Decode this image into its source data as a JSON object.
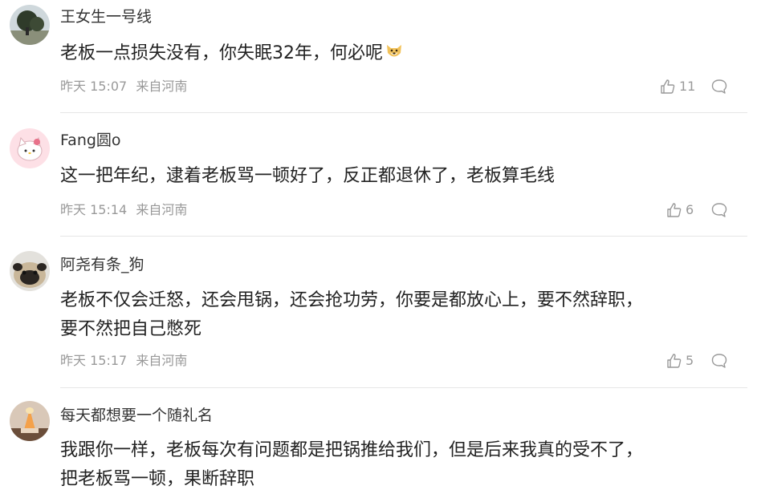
{
  "comments": [
    {
      "username": "王女生一号线",
      "content_lines": [
        "老板一点损失没有，你失眠32年，何必呢"
      ],
      "content_emoji": "dog-face-emoji",
      "date": "昨天",
      "time": "15:07",
      "location": "来自河南",
      "likes": "11",
      "avatar": "landscape-avatar"
    },
    {
      "username": "Fang圆o",
      "content_lines": [
        "这一把年纪，逮着老板骂一顿好了，反正都退休了，老板算毛线"
      ],
      "date": "昨天",
      "time": "15:14",
      "location": "来自河南",
      "likes": "6",
      "avatar": "hello-kitty-avatar"
    },
    {
      "username": "阿尧有条_狗",
      "content_lines": [
        "老板不仅会迁怒，还会甩锅，还会抢功劳，你要是都放心上，要不然辞职，",
        "要不然把自己憋死"
      ],
      "date": "昨天",
      "time": "15:17",
      "location": "来自河南",
      "likes": "5",
      "avatar": "pug-avatar"
    },
    {
      "username": "每天都想要一个随礼名",
      "content_lines": [
        "我跟你一样，老板每次有问题都是把锅推给我们，但是后来我真的受不了，",
        "把老板骂一顿，果断辞职"
      ],
      "avatar": "dessert-avatar"
    }
  ]
}
